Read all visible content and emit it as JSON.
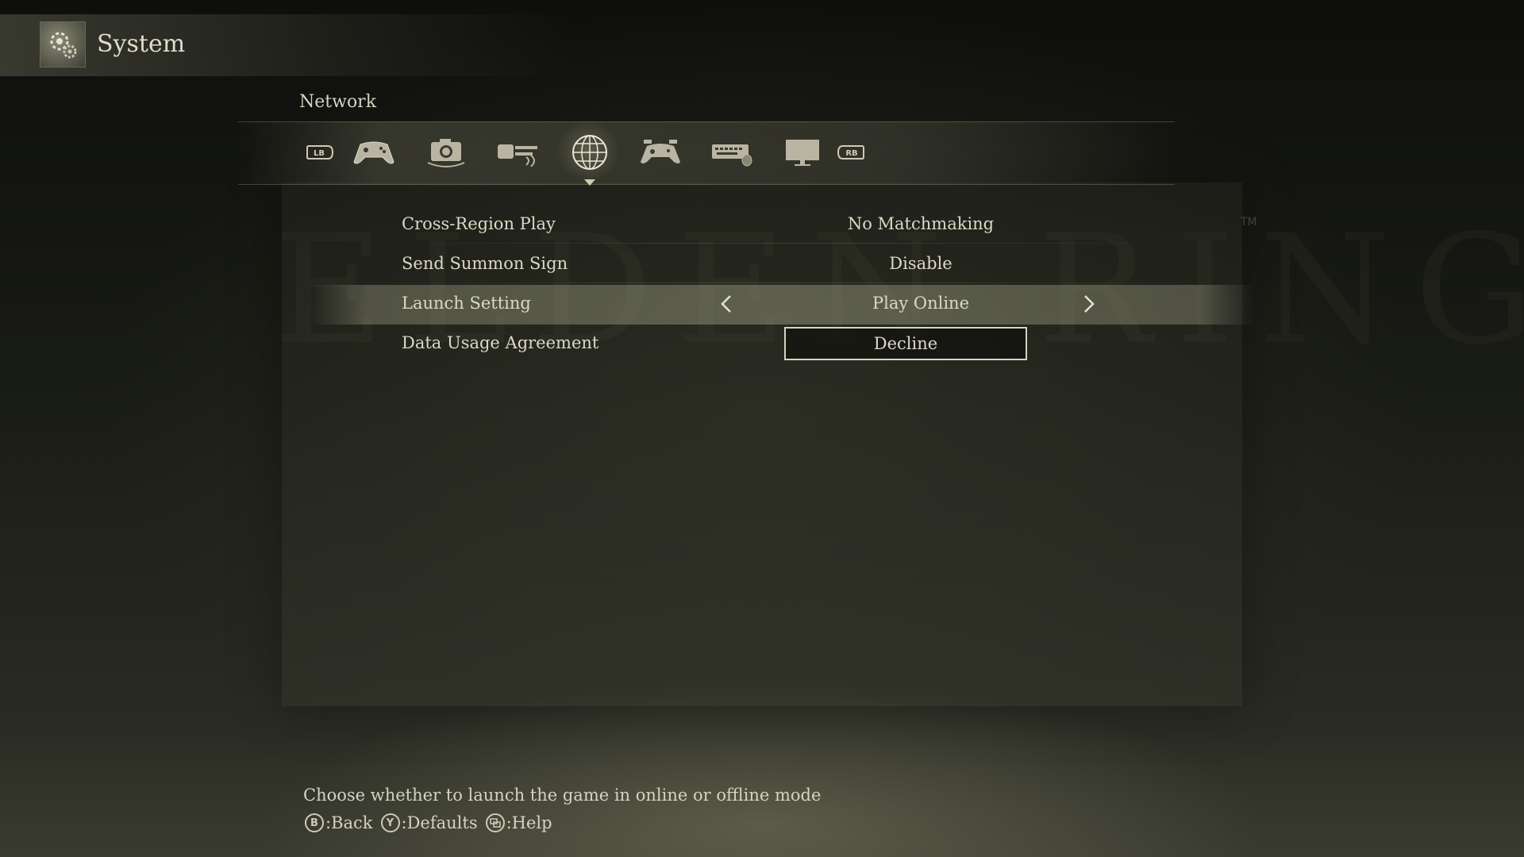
{
  "header": {
    "title": "System",
    "icon": "gear-icon"
  },
  "section": {
    "title": "Network"
  },
  "tabs": [
    {
      "icon": "lb-bumper-icon",
      "active": false
    },
    {
      "icon": "gamepad-icon",
      "active": false
    },
    {
      "icon": "camera-icon",
      "active": false
    },
    {
      "icon": "sound-icon",
      "active": false
    },
    {
      "icon": "globe-network-icon",
      "active": true
    },
    {
      "icon": "controller-settings-icon",
      "active": false
    },
    {
      "icon": "keyboard-mouse-icon",
      "active": false
    },
    {
      "icon": "display-monitor-icon",
      "active": false
    },
    {
      "icon": "rb-bumper-icon",
      "active": false
    }
  ],
  "watermark": "ELDEN RING",
  "trademark": "TM",
  "settings": [
    {
      "label": "Cross-Region Play",
      "value": "No Matchmaking"
    },
    {
      "label": "Send Summon Sign",
      "value": "Disable"
    },
    {
      "label": "Launch Setting",
      "value": "Play Online"
    },
    {
      "label": "Data Usage Agreement",
      "value": "Decline"
    }
  ],
  "footer": {
    "help": "Choose whether to launch the game in online or offline mode",
    "prompts": [
      {
        "button": "B",
        "label": ":Back"
      },
      {
        "button": "Y",
        "label": ":Defaults"
      },
      {
        "button": "view-icon",
        "label": ":Help"
      }
    ]
  },
  "colors": {
    "text": "#d9d4c2",
    "highlight": "#9a9a80",
    "background": "#121410"
  }
}
